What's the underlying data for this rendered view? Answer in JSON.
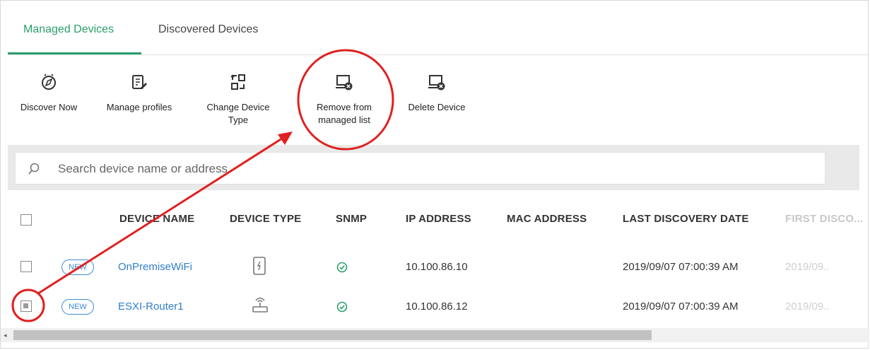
{
  "tabs": [
    {
      "label": "Managed Devices",
      "active": true
    },
    {
      "label": "Discovered Devices",
      "active": false
    }
  ],
  "toolbar": {
    "discover_now": "Discover Now",
    "manage_profiles": "Manage profiles",
    "change_device_type_1": "Change Device",
    "change_device_type_2": "Type",
    "remove_from_1": "Remove from",
    "remove_from_2": "managed list",
    "delete_device": "Delete Device"
  },
  "search": {
    "placeholder": "Search device name or address"
  },
  "table": {
    "headers": [
      "DEVICE NAME",
      "DEVICE TYPE",
      "SNMP",
      "IP ADDRESS",
      "MAC ADDRESS",
      "LAST DISCOVERY DATE",
      "FIRST DISCO..."
    ],
    "rows": [
      {
        "badge": "NEW",
        "name": "OnPremiseWiFi",
        "device_type_icon": "tablet-icon",
        "snmp": "check",
        "ip": "10.100.86.10",
        "mac": "",
        "last_discovery": "2019/09/07 07:00:39 AM",
        "first_discovery": "2019/09..",
        "checked": false
      },
      {
        "badge": "NEW",
        "name": "ESXI-Router1",
        "device_type_icon": "router-icon",
        "snmp": "check",
        "ip": "10.100.86.12",
        "mac": "",
        "last_discovery": "2019/09/07 07:00:39 AM",
        "first_discovery": "2019/09..",
        "checked": true
      }
    ]
  },
  "colors": {
    "accent": "#2b9e6b",
    "link": "#2f7fc9",
    "annotation": "#e02020"
  }
}
